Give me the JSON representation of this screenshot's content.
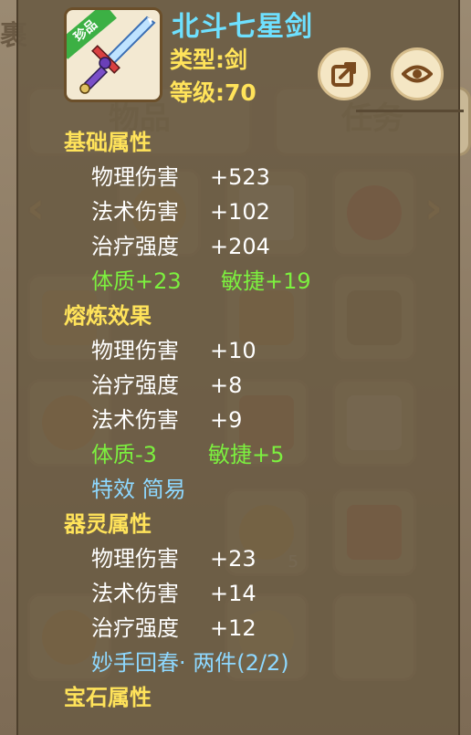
{
  "bg": {
    "tab_left": "物品",
    "tab_right": "任务",
    "edge_char": "裹",
    "slot_count": "5"
  },
  "item": {
    "rarity": "珍品",
    "name": "北斗七星剑",
    "type": "类型:剑",
    "level": "等级:70"
  },
  "buttons": {
    "share": "share-icon",
    "view": "eye-icon"
  },
  "sections": {
    "base": {
      "title": "基础属性",
      "stats": [
        {
          "k": "物理伤害",
          "v": "+523"
        },
        {
          "k": "法术伤害",
          "v": "+102"
        },
        {
          "k": "治疗强度",
          "v": "+204"
        }
      ],
      "bonus_a": "体质+23",
      "bonus_b": "敏捷+19"
    },
    "refine": {
      "title": "熔炼效果",
      "stats": [
        {
          "k": "物理伤害",
          "v": "+10"
        },
        {
          "k": "治疗强度",
          "v": "+8"
        },
        {
          "k": "法术伤害",
          "v": "+9"
        }
      ],
      "bonus_a": "体质-3",
      "bonus_b": "敏捷+5",
      "effect": "特效 简易"
    },
    "spirit": {
      "title": "器灵属性",
      "stats": [
        {
          "k": "物理伤害",
          "v": "+23"
        },
        {
          "k": "法术伤害",
          "v": "+14"
        },
        {
          "k": "治疗强度",
          "v": "+12"
        }
      ],
      "set": "妙手回春· 两件(2/2)"
    },
    "gem": {
      "title": "宝石属性"
    }
  },
  "colors": {
    "title": "#6ee0ff",
    "section": "#ffe35a",
    "bonus": "#7cf03f",
    "effect": "#8ed8ff"
  }
}
